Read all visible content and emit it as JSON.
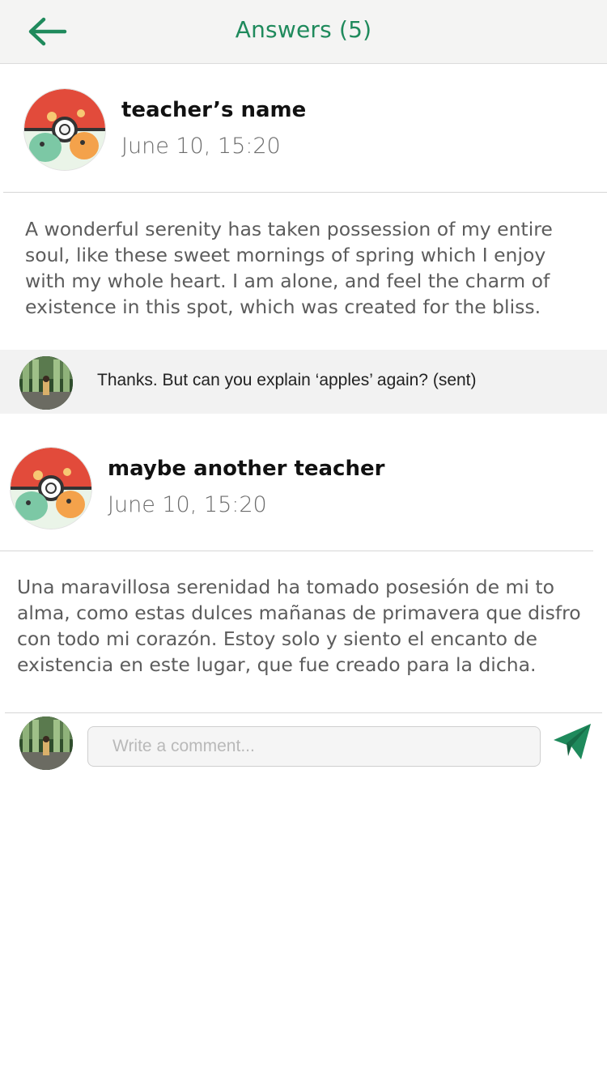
{
  "header": {
    "back_icon": "arrow-left-icon",
    "title": "Answers (5)"
  },
  "colors": {
    "accent": "#1f8a5c",
    "header_bg": "#f4f4f3",
    "strip_bg": "#f2f2f2"
  },
  "answers": [
    {
      "author": "teacher’s name",
      "date": "June 10, 15:20",
      "avatar_icon": "pokemon-avatar-icon",
      "body_lines": [
        "A wonderful serenity has taken possession of my entire",
        "soul, like these sweet mornings of spring which I enjoy",
        "with my whole heart. I am alone, and feel the charm of",
        "existence in this spot, which was created for the bliss."
      ]
    },
    {
      "author": "maybe another teacher",
      "date": "June 10, 15:20",
      "avatar_icon": "pokemon-avatar-icon",
      "body_lines": [
        "Una maravillosa serenidad ha tomado posesión de mi to",
        "alma, como estas dulces mañanas de primavera que disfro",
        "con todo mi corazón. Estoy solo y siento el encanto de",
        "existencia en este lugar, que fue creado para la dicha."
      ]
    }
  ],
  "sent_comment": {
    "avatar_icon": "user-photo-avatar-icon",
    "text": "Thanks. But can you explain ‘apples’ again? (sent)"
  },
  "composer": {
    "avatar_icon": "user-photo-avatar-icon",
    "placeholder": "Write a comment...",
    "value": "",
    "send_icon": "paper-plane-send-icon"
  }
}
